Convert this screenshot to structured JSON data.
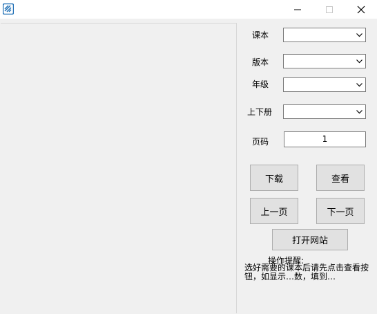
{
  "window": {
    "min_glyph": "—",
    "close_glyph": "✕"
  },
  "form": {
    "textbook_label": "课本",
    "edition_label": "版本",
    "grade_label": "年级",
    "volume_label": "上下册",
    "page_label": "页码",
    "textbook_value": "",
    "edition_value": "",
    "grade_value": "",
    "volume_value": "",
    "page_value": "1"
  },
  "buttons": {
    "download": "下载",
    "view": "查看",
    "prev_page": "上一页",
    "next_page": "下一页",
    "open_site": "打开网站"
  },
  "tips": {
    "title": "操作提醒:",
    "body": "选好需要的课本后请先点击查看按钮，如显示…数，填到…"
  },
  "colors": {
    "background": "#f0f0f0",
    "button_face": "#e1e1e1",
    "app_icon": "#1f6fb5"
  }
}
